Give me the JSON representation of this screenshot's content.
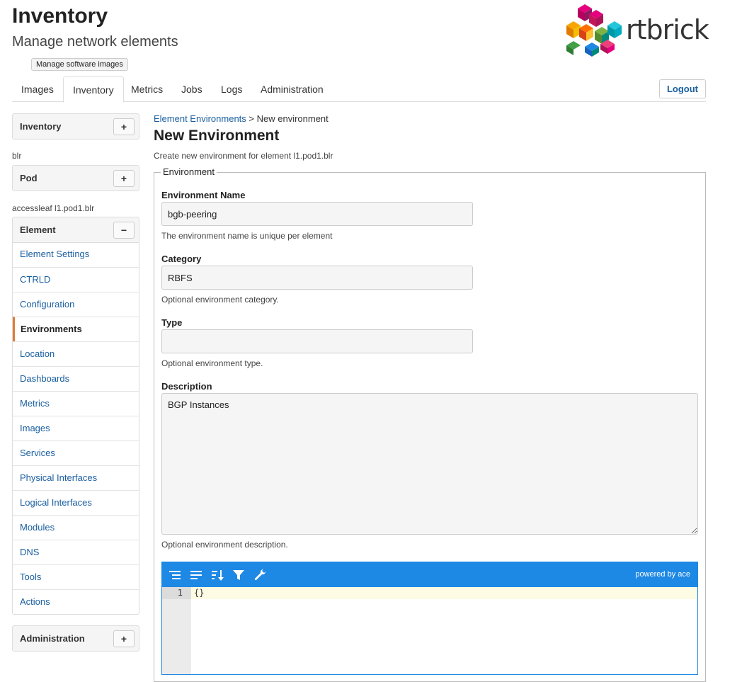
{
  "header": {
    "title": "Inventory",
    "subtitle": "Manage network elements",
    "logo_text": "rtbrick",
    "tooltip": "Manage software images"
  },
  "nav": {
    "tabs": [
      "Images",
      "Inventory",
      "Metrics",
      "Jobs",
      "Logs",
      "Administration"
    ],
    "active": "Inventory",
    "logout": "Logout"
  },
  "sidebar": {
    "inventory_title": "Inventory",
    "inventory_btn": "+",
    "inventory_selected": "blr",
    "pod_title": "Pod",
    "pod_btn": "+",
    "pod_selected": "accessleaf l1.pod1.blr",
    "element_title": "Element",
    "element_btn": "−",
    "element_items": [
      "Element Settings",
      "CTRLD",
      "Configuration",
      "Environments",
      "Location",
      "Dashboards",
      "Metrics",
      "Images",
      "Services",
      "Physical Interfaces",
      "Logical Interfaces",
      "Modules",
      "DNS",
      "Tools",
      "Actions"
    ],
    "element_active": "Environments",
    "admin_title": "Administration",
    "admin_btn": "+"
  },
  "main": {
    "breadcrumb_link": "Element Environments",
    "breadcrumb_sep": " > ",
    "breadcrumb_current": "New environment",
    "title": "New Environment",
    "subtitle": "Create new environment for element l1.pod1.blr",
    "legend": "Environment",
    "fields": {
      "name_label": "Environment Name",
      "name_value": "bgb-peering",
      "name_help": "The environment name is unique per element",
      "category_label": "Category",
      "category_value": "RBFS",
      "category_help": "Optional environment category.",
      "type_label": "Type",
      "type_value": "",
      "type_help": "Optional environment type.",
      "description_label": "Description",
      "description_value": "BGP Instances",
      "description_help": "Optional environment description."
    },
    "editor": {
      "powered_by": "powered by ace",
      "line_number": "1",
      "code": "{}",
      "toolbar_icons": [
        "format-icon",
        "compact-icon",
        "sort-icon",
        "filter-icon",
        "repair-icon"
      ]
    }
  },
  "colors": {
    "accent": "#1e88e5",
    "link": "#1a5fa0",
    "active_marker": "#e07b39"
  }
}
